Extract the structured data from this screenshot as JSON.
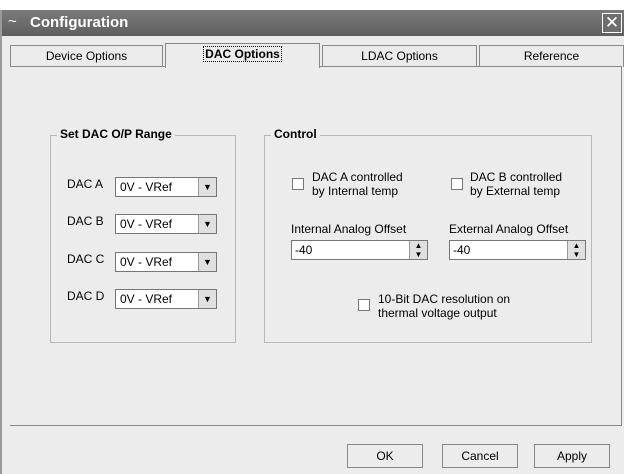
{
  "window": {
    "title": "Configuration",
    "close_glyph": "✕",
    "logo_glyph": "~"
  },
  "tabs": [
    "Device Options",
    "DAC Options",
    "LDAC Options",
    "Reference"
  ],
  "dac_range": {
    "title": "Set DAC O/P Range",
    "rows": [
      {
        "label": "DAC A",
        "value": "0V - VRef"
      },
      {
        "label": "DAC B",
        "value": "0V - VRef"
      },
      {
        "label": "DAC C",
        "value": "0V - VRef"
      },
      {
        "label": "DAC D",
        "value": "0V - VRef"
      }
    ]
  },
  "control": {
    "title": "Control",
    "dac_a": {
      "line1": "DAC A controlled",
      "line2": "by Internal temp"
    },
    "dac_b": {
      "line1": "DAC B controlled",
      "line2": "by External temp"
    },
    "internal_offset": {
      "label": "Internal Analog Offset",
      "value": "-40"
    },
    "external_offset": {
      "label": "External Analog Offset",
      "value": "-40"
    },
    "resolution": {
      "line1": "10-Bit DAC resolution on",
      "line2": "thermal voltage output"
    }
  },
  "buttons": {
    "ok": "OK",
    "cancel": "Cancel",
    "apply": "Apply"
  }
}
